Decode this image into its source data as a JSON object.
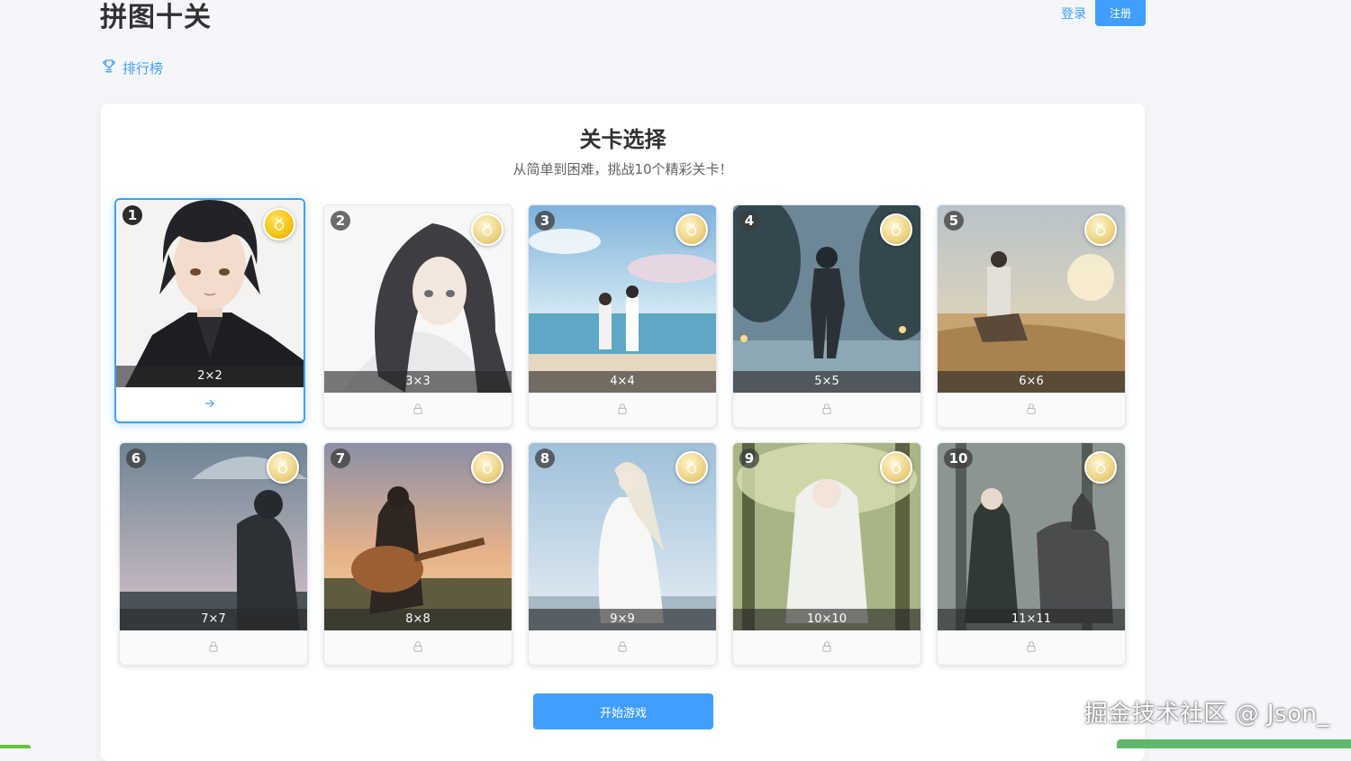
{
  "header": {
    "title": "拼图十关",
    "login_label": "登录",
    "register_label": "注册",
    "leaderboard_label": "排行榜"
  },
  "panel": {
    "title": "关卡选择",
    "subtitle": "从简单到困难，挑战10个精彩关卡！"
  },
  "levels": [
    {
      "number": "1",
      "grid": "2×2",
      "state": "current"
    },
    {
      "number": "2",
      "grid": "3×3",
      "state": "locked"
    },
    {
      "number": "3",
      "grid": "4×4",
      "state": "locked"
    },
    {
      "number": "4",
      "grid": "5×5",
      "state": "locked"
    },
    {
      "number": "5",
      "grid": "6×6",
      "state": "locked"
    },
    {
      "number": "6",
      "grid": "7×7",
      "state": "locked"
    },
    {
      "number": "7",
      "grid": "8×8",
      "state": "locked"
    },
    {
      "number": "8",
      "grid": "9×9",
      "state": "locked"
    },
    {
      "number": "9",
      "grid": "10×10",
      "state": "locked"
    },
    {
      "number": "10",
      "grid": "11×11",
      "state": "locked"
    }
  ],
  "start_button_label": "开始游戏",
  "watermark": "掘金技术社区 @ Json_",
  "colors": {
    "accent": "#409eff",
    "page_background": "#f4f6f9",
    "medal_gold": "#f5c518",
    "medal_pale": "#eed68a"
  },
  "icons": {
    "leaderboard": "trophy-icon",
    "medal": "medal-icon",
    "lock": "lock-icon",
    "go": "arrow-right-icon"
  }
}
